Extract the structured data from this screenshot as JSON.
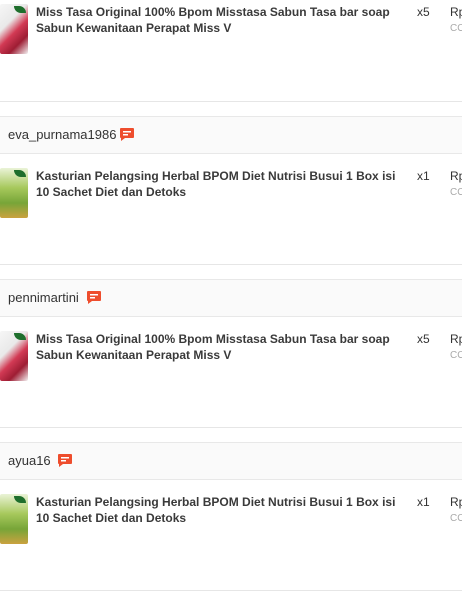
{
  "orders": [
    {
      "username": "",
      "product_title": "Miss Tasa Original 100% Bpom Misstasa Sabun Tasa bar soap Sabun Kewanitaan Perapat Miss V",
      "quantity": "x5",
      "price_prefix": "Rp",
      "payment_code": "CO",
      "thumb_icon": "soap-product-icon"
    },
    {
      "username": "eva_purnama1986",
      "product_title": "Kasturian Pelangsing Herbal BPOM Diet Nutrisi Busui 1 Box isi 10 Sachet Diet dan Detoks",
      "quantity": "x1",
      "price_prefix": "Rp",
      "payment_code": "CO",
      "thumb_icon": "herbal-product-icon"
    },
    {
      "username": "pennimartini",
      "product_title": "Miss Tasa Original 100% Bpom Misstasa Sabun Tasa bar soap Sabun Kewanitaan Perapat Miss V",
      "quantity": "x5",
      "price_prefix": "Rp",
      "payment_code": "CO",
      "thumb_icon": "soap-product-icon"
    },
    {
      "username": "ayua16",
      "product_title": "Kasturian Pelangsing Herbal BPOM Diet Nutrisi Busui 1 Box isi 10 Sachet Diet dan Detoks",
      "quantity": "x1",
      "price_prefix": "Rp",
      "payment_code": "CO",
      "thumb_icon": "herbal-product-icon"
    }
  ],
  "colors": {
    "chat_icon": "#ee4d2d",
    "header_bg": "#fafafa",
    "divider": "#e6e6e6"
  }
}
